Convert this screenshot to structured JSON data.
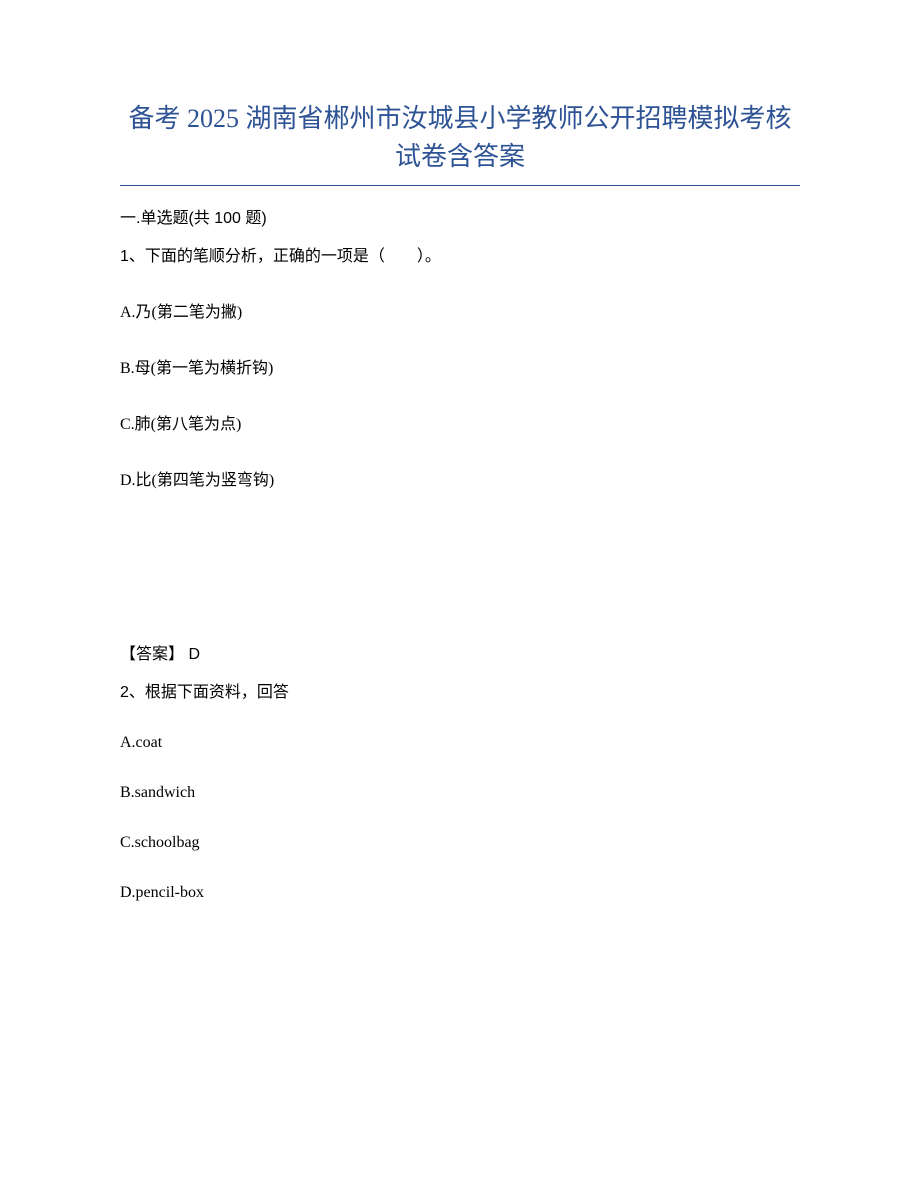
{
  "title_line1": "备考 2025 湖南省郴州市汝城县小学教师公开招聘模拟考核",
  "title_line2": "试卷含答案",
  "section_header": "一.单选题(共 100 题)",
  "q1": {
    "stem": "1、下面的笔顺分析，正确的一项是（　　）。",
    "options": {
      "A": "A.乃(第二笔为撇)",
      "B": "B.母(第一笔为横折钩)",
      "C": "C.肺(第八笔为点)",
      "D": "D.比(第四笔为竖弯钩)"
    },
    "answer_label": "【答案】  D"
  },
  "q2": {
    "stem": "2、根据下面资料，回答",
    "options": {
      "A": "A.coat",
      "B": "B.sandwich",
      "C": "C.schoolbag",
      "D": "D.pencil-box"
    }
  }
}
